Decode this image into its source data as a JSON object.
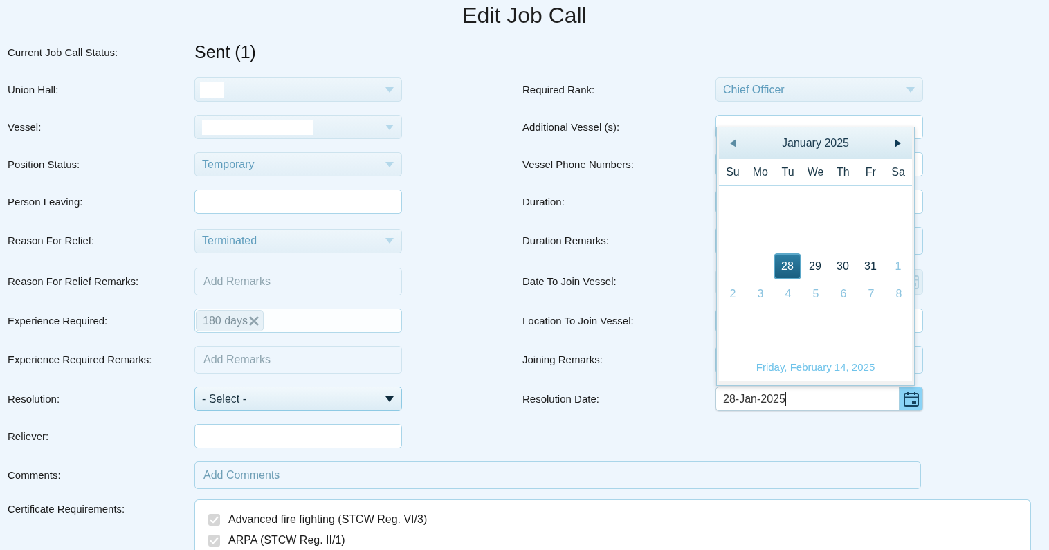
{
  "title": "Edit Job Call",
  "status": {
    "label": "Current Job Call Status:",
    "value": "Sent (1)"
  },
  "rows": [
    {
      "left": {
        "label": "Union Hall:",
        "field": {
          "kind": "select",
          "disabled": true,
          "redaction": {
            "kind": "short"
          }
        }
      },
      "right": {
        "label": "Required Rank:",
        "field": {
          "kind": "select",
          "disabled": true,
          "value": "Chief Officer"
        }
      }
    },
    {
      "left": {
        "label": "Vessel:",
        "field": {
          "kind": "select",
          "disabled": true,
          "redaction": {
            "kind": "long"
          }
        }
      },
      "right": {
        "label": "Additional Vessel (s):",
        "field": {
          "kind": "text"
        }
      }
    },
    {
      "left": {
        "label": "Position Status:",
        "field": {
          "kind": "select",
          "disabled": true,
          "value": "Temporary"
        }
      },
      "right": {
        "label": "Vessel Phone Numbers:",
        "field": {
          "kind": "text"
        }
      }
    },
    {
      "left": {
        "label": "Person Leaving:",
        "field": {
          "kind": "text",
          "disabled": false
        }
      },
      "right": {
        "label": "Duration:",
        "field": {
          "kind": "text"
        }
      }
    },
    {
      "left": {
        "label": "Reason For Relief:",
        "field": {
          "kind": "select",
          "disabled": true,
          "value": "Terminated"
        }
      },
      "right": {
        "label": "Duration Remarks:",
        "field": {
          "kind": "textarea"
        }
      }
    },
    {
      "left": {
        "label": "Reason For Relief Remarks:",
        "field": {
          "kind": "textarea",
          "disabled": true,
          "placeholder": "Add Remarks"
        }
      },
      "right": {
        "label": "Date To Join Vessel:",
        "field": {
          "kind": "date",
          "disabled": true
        }
      }
    },
    {
      "left": {
        "label": "Experience Required:",
        "field": {
          "kind": "tags",
          "disabled": true,
          "tags": [
            {
              "label": "180 days"
            }
          ]
        }
      },
      "right": {
        "label": "Location To Join Vessel:",
        "field": {
          "kind": "text"
        }
      }
    },
    {
      "left": {
        "label": "Experience Required Remarks:",
        "field": {
          "kind": "textarea",
          "disabled": true,
          "placeholder": "Add Remarks"
        }
      },
      "right": {
        "label": "Joining Remarks:",
        "field": {
          "kind": "textarea"
        }
      }
    },
    {
      "left": {
        "label": "Resolution:",
        "field": {
          "kind": "select",
          "disabled": false,
          "value": "- Select -"
        }
      },
      "right": {
        "label": "Resolution Date:",
        "field": {
          "kind": "date",
          "disabled": false,
          "value": "28-Jan-2025",
          "focused": true,
          "calendar": {
            "month": "January 2025",
            "previous": {
              "disabled": true
            },
            "next": {
              "disabled": false
            },
            "weekdays": [
              "Su",
              "Mo",
              "Tu",
              "We",
              "Th",
              "Fr",
              "Sa"
            ],
            "weeks": [
              {
                "days": [
                  {
                    "kind": "blank"
                  },
                  {
                    "kind": "blank"
                  },
                  {
                    "kind": "current_month",
                    "label": "28",
                    "selected": true
                  },
                  {
                    "kind": "current_month",
                    "label": "29",
                    "selected": false
                  },
                  {
                    "kind": "current_month",
                    "label": "30",
                    "selected": false
                  },
                  {
                    "kind": "current_month",
                    "label": "31",
                    "selected": false
                  },
                  {
                    "kind": "other_month",
                    "label": "1",
                    "selected": false
                  }
                ]
              },
              {
                "days": [
                  {
                    "kind": "other_month",
                    "label": "2",
                    "selected": false
                  },
                  {
                    "kind": "other_month",
                    "label": "3",
                    "selected": false
                  },
                  {
                    "kind": "other_month",
                    "label": "4",
                    "selected": false
                  },
                  {
                    "kind": "other_month",
                    "label": "5",
                    "selected": false
                  },
                  {
                    "kind": "other_month",
                    "label": "6",
                    "selected": false
                  },
                  {
                    "kind": "other_month",
                    "label": "7",
                    "selected": false
                  },
                  {
                    "kind": "other_month",
                    "label": "8",
                    "selected": false
                  }
                ]
              }
            ],
            "footer": "Friday, February 14, 2025"
          }
        }
      }
    },
    {
      "left": {
        "label": "Reliever:",
        "field": {
          "kind": "text",
          "disabled": false
        }
      }
    }
  ],
  "comments": {
    "label": "Comments:",
    "placeholder": "Add Comments",
    "disabled": false
  },
  "certificates": {
    "label": "Certificate Requirements:",
    "items": [
      {
        "label": "Advanced fire fighting (STCW Reg. VI/3)",
        "checked": true,
        "disabled": true
      },
      {
        "label": "ARPA (STCW Reg. II/1)",
        "checked": true,
        "disabled": true
      }
    ]
  }
}
